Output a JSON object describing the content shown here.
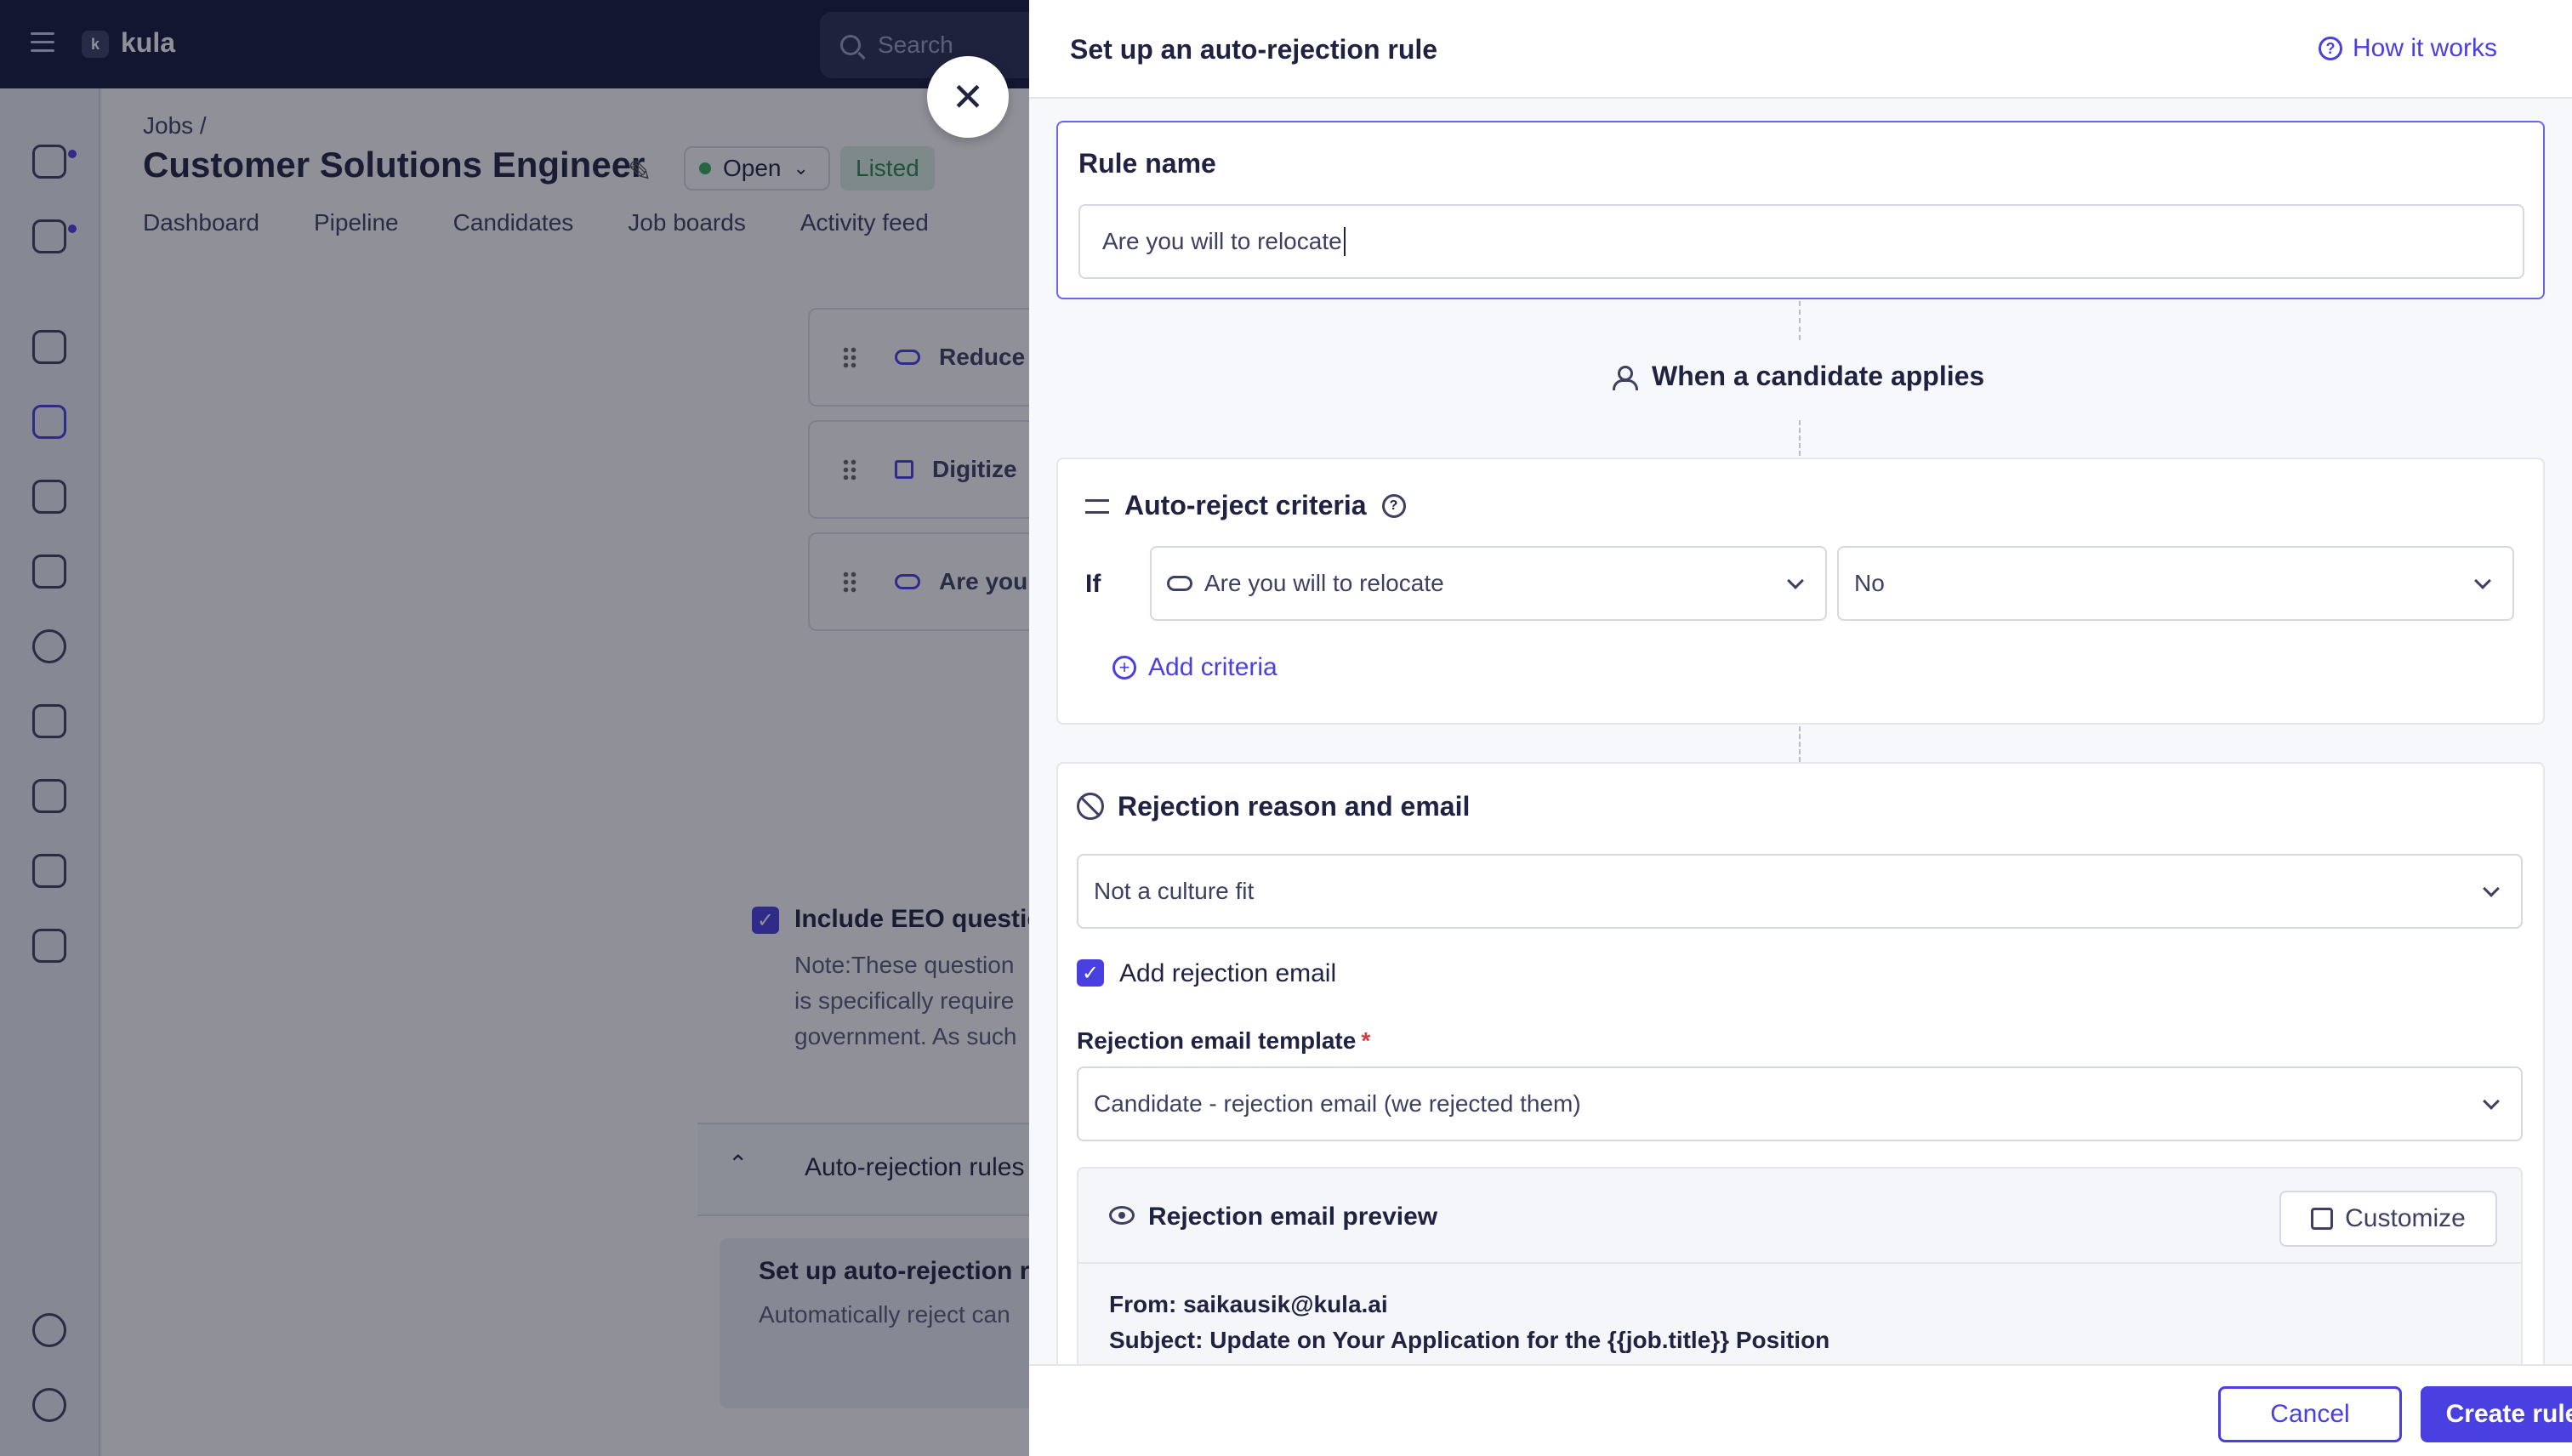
{
  "app": {
    "logo_text": "kula",
    "search_placeholder": "Search"
  },
  "job": {
    "breadcrumb": "Jobs /",
    "title": "Customer Solutions Engineer",
    "status": "Open",
    "listing": "Listed",
    "tabs": [
      "Dashboard",
      "Pipeline",
      "Candidates",
      "Job boards",
      "Activity feed"
    ]
  },
  "application_form": {
    "questions": [
      "Reduce",
      "Digitize",
      "Are you"
    ],
    "eeo_label": "Include EEO question",
    "eeo_note": [
      "Note:These question",
      "is specifically require",
      "government. As such"
    ],
    "auto_rejection_section": "Auto-rejection rules",
    "setup_title": "Set up auto-rejection ru",
    "setup_desc": "Automatically reject can"
  },
  "panel": {
    "title": "Set up an auto-rejection rule",
    "how_it_works": "How it works",
    "rule_name_label": "Rule name",
    "rule_name_value": "Are you will to relocate",
    "when_label": "When a candidate applies",
    "criteria": {
      "title": "Auto-reject criteria",
      "if_label": "If",
      "question": "Are you will to relocate",
      "answer": "No",
      "add_label": "Add criteria"
    },
    "rejection": {
      "title": "Rejection reason and email",
      "reason": "Not a culture fit",
      "add_email_label": "Add rejection email",
      "template_label": "Rejection email template",
      "required_mark": "*",
      "template_value": "Candidate - rejection email (we rejected them)",
      "preview_title": "Rejection email preview",
      "customize_label": "Customize",
      "from": "From: saikausik@kula.ai",
      "subject": "Subject: Update on Your Application for the {{job.title}} Position"
    },
    "footer": {
      "cancel": "Cancel",
      "create": "Create rule"
    }
  }
}
